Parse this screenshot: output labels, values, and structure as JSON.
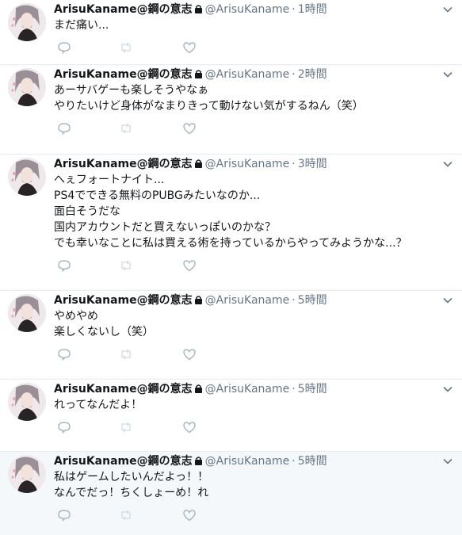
{
  "account": {
    "name": "ArisuKaname@鋼の意志",
    "handle": "@ArisuKaname"
  },
  "colors": {
    "text": "#14171a",
    "secondary": "#657786",
    "icon": "#aab8c2",
    "border": "#e6ecf0",
    "highlight_bg": "#f5f8fa"
  },
  "icons": {
    "protected": "lock-icon",
    "menu": "chevron-down-icon",
    "reply": "reply-icon",
    "retweet": "retweet-icon",
    "like": "heart-icon"
  },
  "tweets": [
    {
      "time": "1時間",
      "lines": [
        "まだ痛い..."
      ]
    },
    {
      "time": "2時間",
      "lines": [
        "あーサバゲーも楽しそうやなぁ",
        "やりたいけど身体がなまりきって動けない気がするねん（笑）"
      ]
    },
    {
      "time": "3時間",
      "lines": [
        "へぇフォートナイト...",
        "PS4でできる無料のPUBGみたいなのか...",
        "面白そうだな",
        "国内アカウントだと買えないっぽいのかな？",
        "でも幸いなことに私は買える術を持っているからやってみようかな...？"
      ]
    },
    {
      "time": "5時間",
      "lines": [
        "やめやめ",
        "楽しくないし（笑）"
      ]
    },
    {
      "time": "5時間",
      "lines": [
        "れってなんだよ！"
      ]
    },
    {
      "time": "5時間",
      "lines": [
        "私はゲームしたいんだよっ！！",
        "なんでだっ！ちくしょーめ！れ"
      ]
    }
  ]
}
